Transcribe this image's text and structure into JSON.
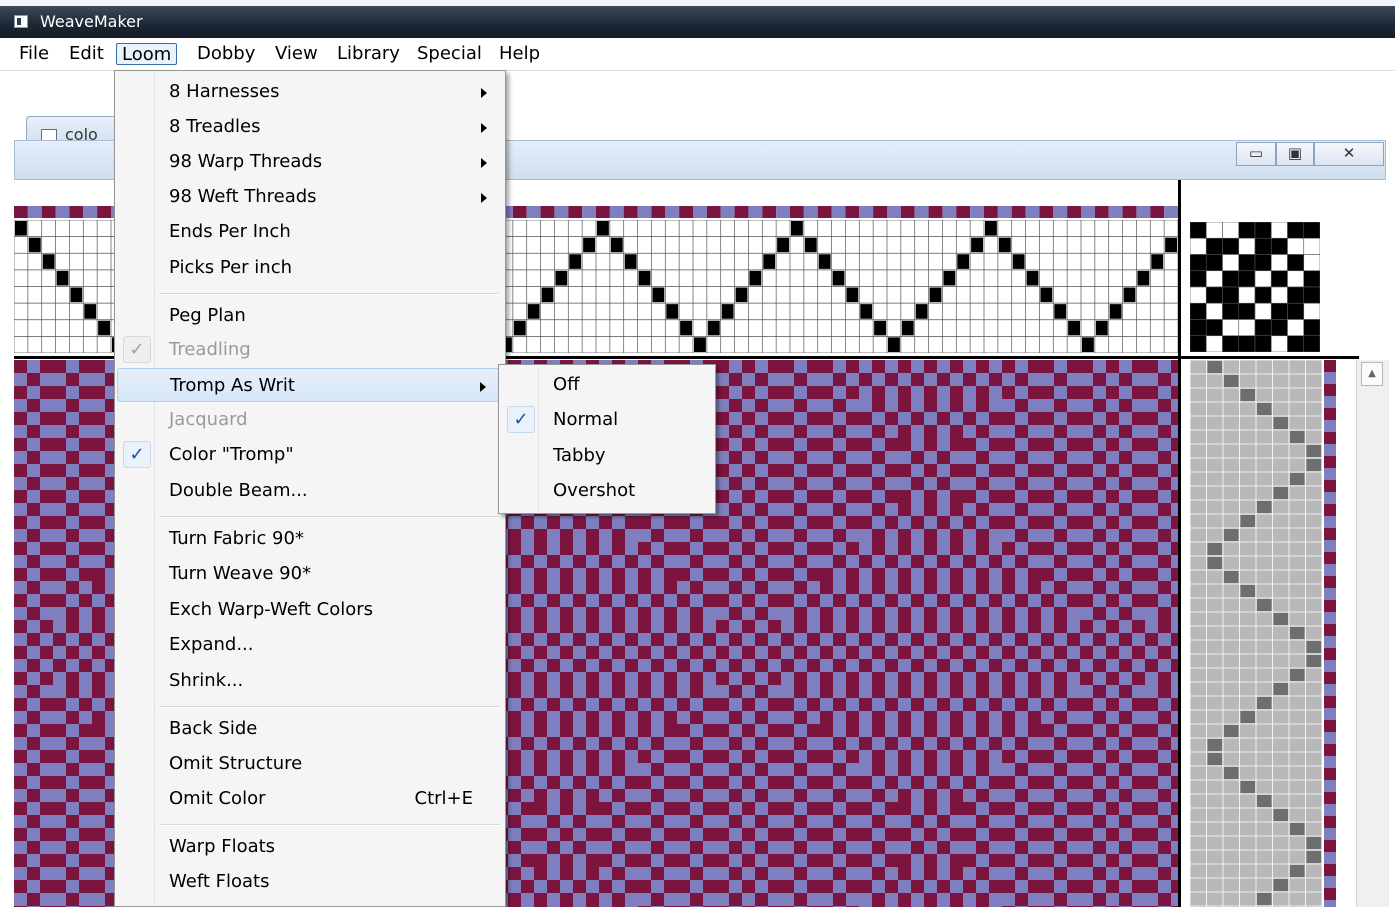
{
  "app": {
    "title": "WeaveMaker"
  },
  "menubar": {
    "items": [
      {
        "label": "File"
      },
      {
        "label": "Edit"
      },
      {
        "label": "Loom"
      },
      {
        "label": "Dobby"
      },
      {
        "label": "View"
      },
      {
        "label": "Library"
      },
      {
        "label": "Special"
      },
      {
        "label": "Help"
      }
    ],
    "active": "Loom"
  },
  "child_window": {
    "tab_label": "colo",
    "buttons": {
      "minimize": "▭",
      "restore": "▣",
      "close": "✕"
    }
  },
  "loom_menu": {
    "items": [
      {
        "label": "8 Harnesses",
        "submenu": true
      },
      {
        "label": "8 Treadles",
        "submenu": true
      },
      {
        "label": "98 Warp Threads",
        "submenu": true
      },
      {
        "label": "98 Weft Threads",
        "submenu": true
      },
      {
        "label": "Ends Per Inch"
      },
      {
        "label": "Picks Per inch"
      },
      {
        "label": "Peg Plan"
      },
      {
        "label": "Treadling",
        "checked": true,
        "disabled": true
      },
      {
        "label": "Tromp As Writ",
        "submenu": true,
        "highlighted": true
      },
      {
        "label": "Jacquard",
        "disabled": true
      },
      {
        "label": "Color \"Tromp\"",
        "checked": true
      },
      {
        "label": "Double Beam..."
      },
      {
        "label": "Turn Fabric 90*"
      },
      {
        "label": "Turn Weave 90*"
      },
      {
        "label": "Exch Warp-Weft Colors"
      },
      {
        "label": "Expand..."
      },
      {
        "label": "Shrink..."
      },
      {
        "label": "Back Side"
      },
      {
        "label": "Omit Structure"
      },
      {
        "label": "Omit Color",
        "shortcut": "Ctrl+E"
      },
      {
        "label": "Warp Floats"
      },
      {
        "label": "Weft Floats"
      }
    ],
    "check_mark": "✓"
  },
  "tromp_submenu": {
    "items": [
      {
        "label": "Off"
      },
      {
        "label": "Normal",
        "checked": true
      },
      {
        "label": "Tabby"
      },
      {
        "label": "Overshot"
      }
    ]
  },
  "colors": {
    "warp": "#7b1540",
    "weft": "#7f7fbf",
    "grid_line": "#555555",
    "treadling_bg": "#b8b8b8",
    "treadling_mark": "#6e6e6e"
  },
  "threading": {
    "harnesses": 8,
    "visible_columns": 84,
    "sequence": [
      7,
      6,
      5,
      4,
      3,
      2,
      1,
      0,
      1,
      2,
      3,
      4,
      5,
      6,
      7,
      6,
      5,
      4,
      3,
      2,
      1,
      0,
      1,
      2,
      3,
      4,
      5,
      6,
      7,
      6,
      5,
      4,
      3,
      2,
      1,
      0,
      1,
      2,
      3,
      4,
      5,
      6,
      7,
      6,
      5,
      4,
      3,
      2,
      1,
      0,
      1,
      2,
      3,
      4,
      5,
      6,
      7,
      6,
      5,
      4,
      3,
      2,
      1,
      0,
      1,
      2,
      3,
      4,
      5,
      6,
      7,
      6,
      5,
      4,
      3,
      2,
      1,
      0,
      1,
      2,
      3,
      4,
      5,
      6
    ]
  },
  "tieup": {
    "rows": [
      [
        1,
        0,
        0,
        1,
        1,
        0,
        1,
        1
      ],
      [
        0,
        1,
        1,
        0,
        1,
        1,
        0,
        0
      ],
      [
        1,
        1,
        0,
        1,
        1,
        0,
        1,
        0
      ],
      [
        1,
        0,
        1,
        1,
        0,
        1,
        0,
        1
      ],
      [
        0,
        1,
        1,
        0,
        1,
        0,
        1,
        1
      ],
      [
        1,
        0,
        1,
        1,
        0,
        1,
        1,
        0
      ],
      [
        1,
        1,
        0,
        0,
        1,
        1,
        0,
        1
      ],
      [
        1,
        0,
        1,
        1,
        1,
        0,
        1,
        1
      ]
    ]
  }
}
